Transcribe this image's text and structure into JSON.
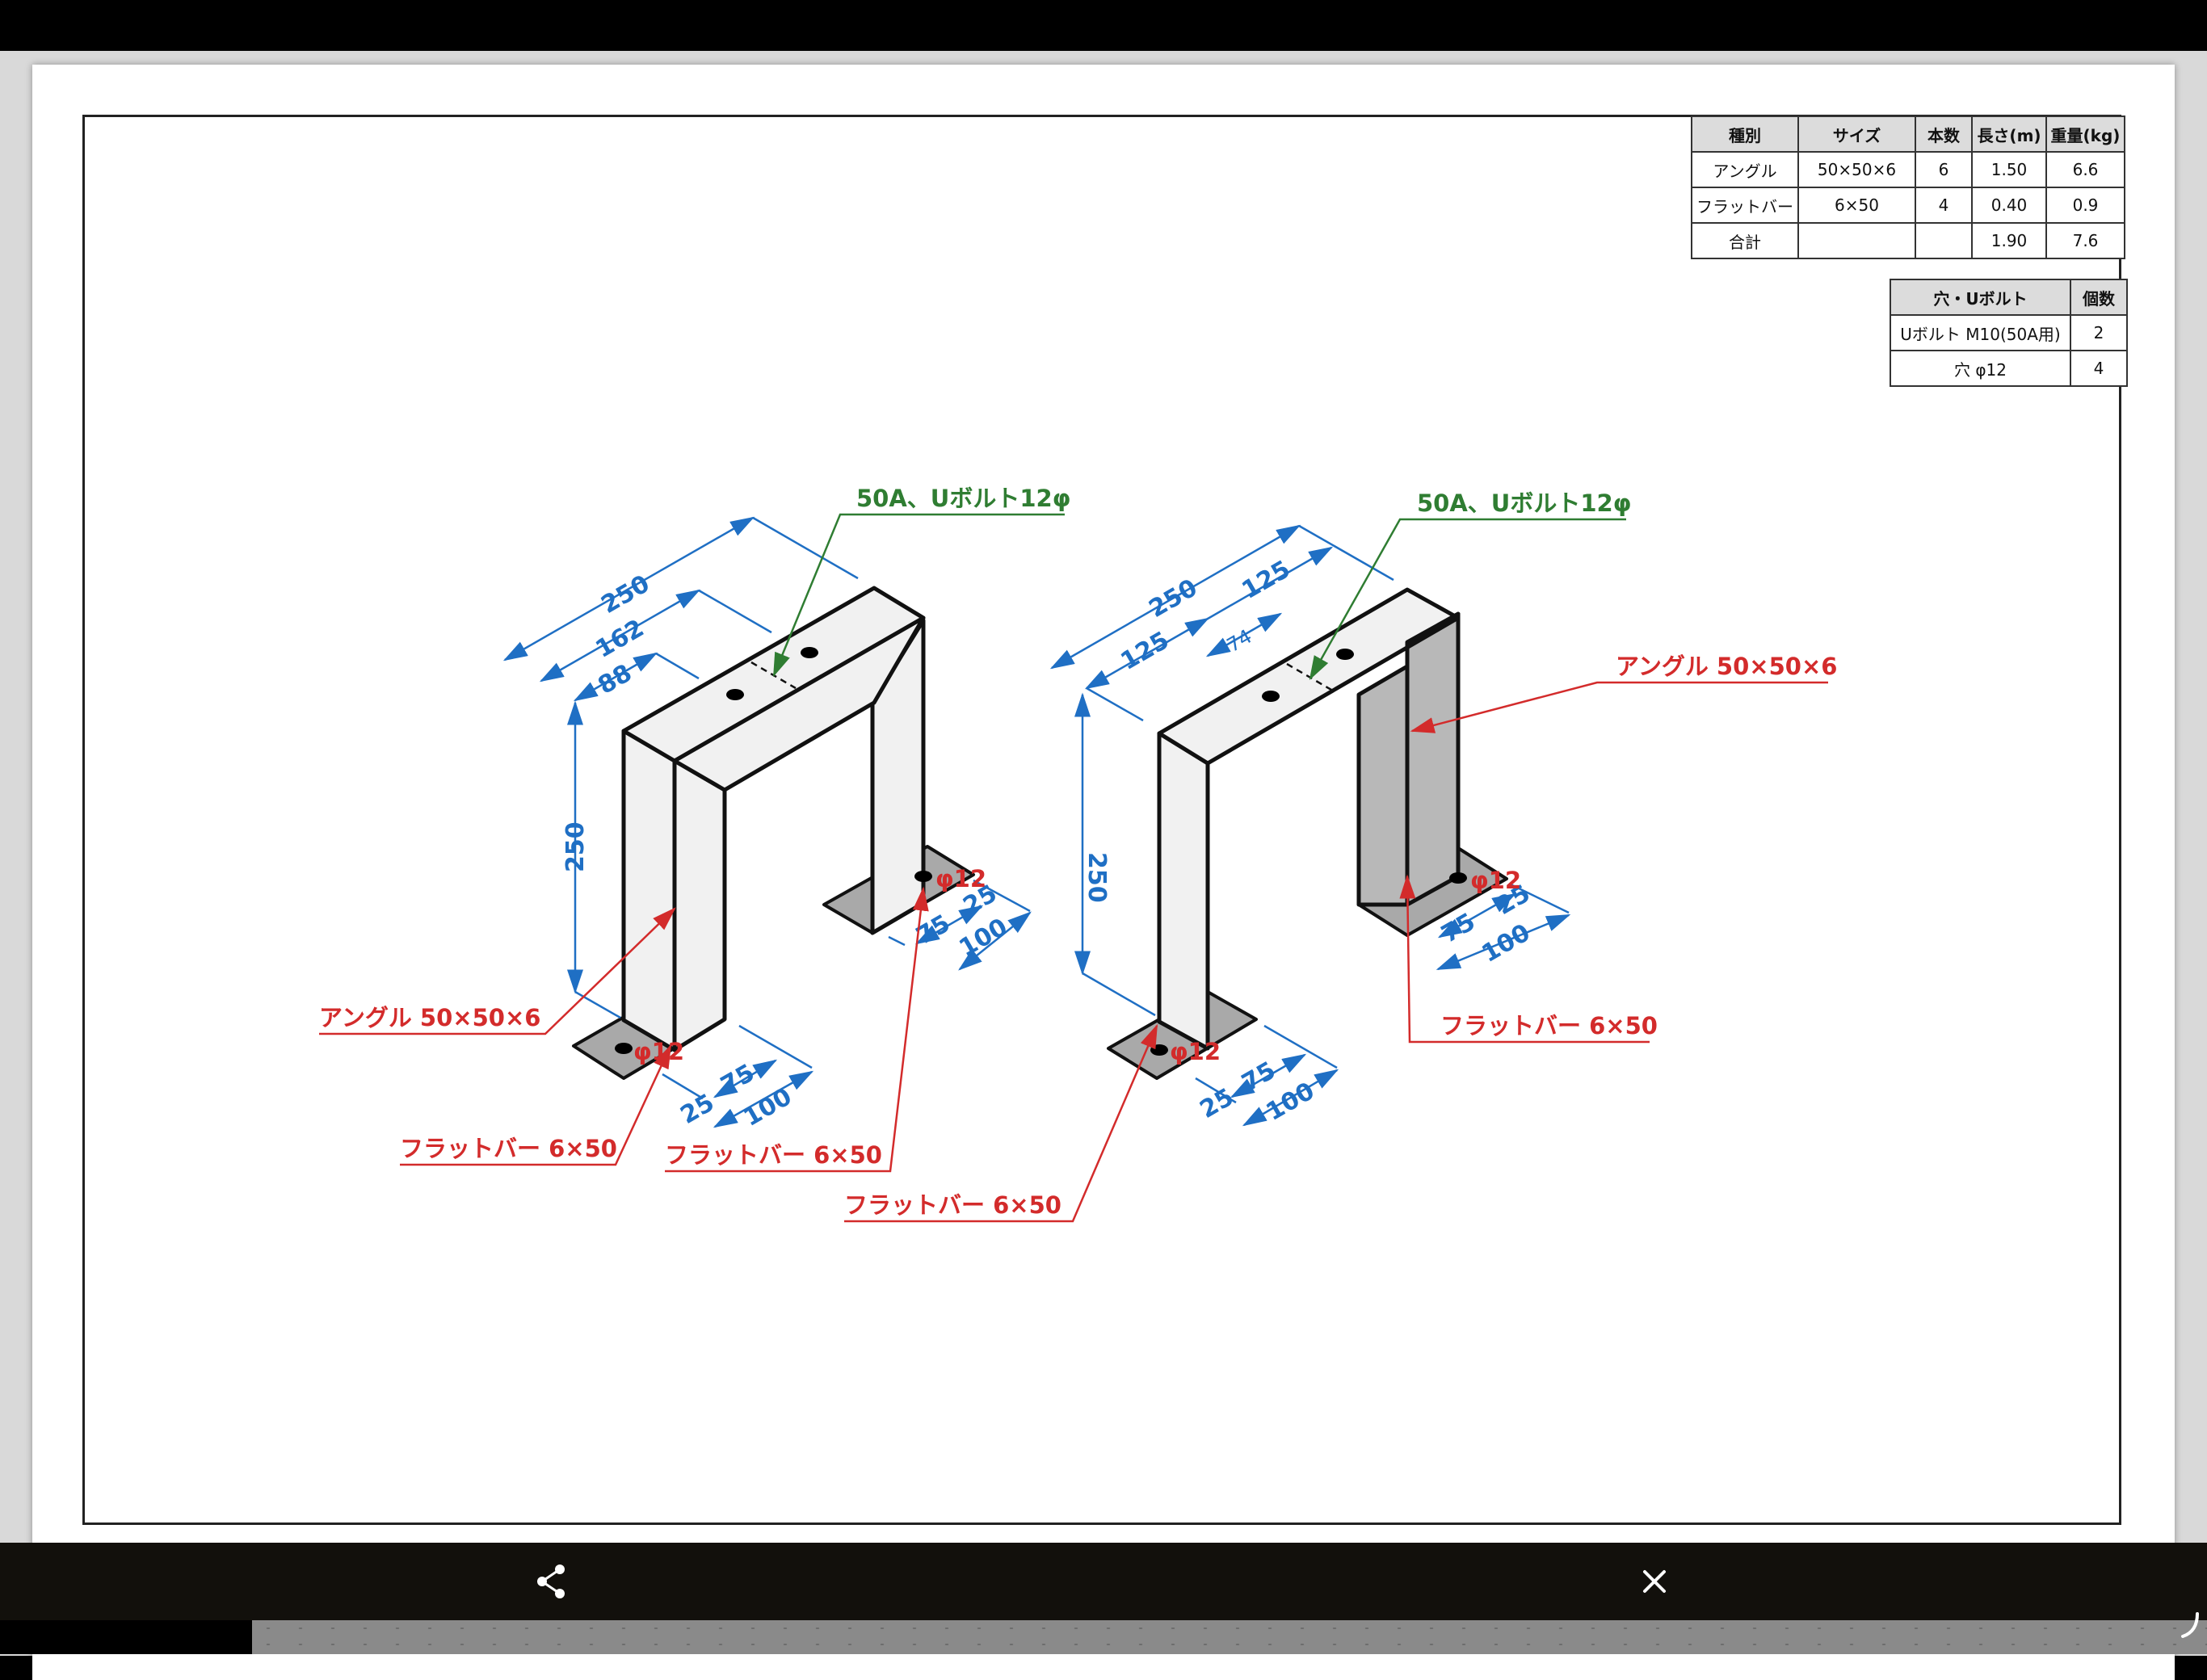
{
  "table1": {
    "headers": [
      "種別",
      "サイズ",
      "本数",
      "長さ(m)",
      "重量(kg)"
    ],
    "rows": [
      [
        "アングル",
        "50×50×6",
        "6",
        "1.50",
        "6.6"
      ],
      [
        "フラットバー",
        "6×50",
        "4",
        "0.40",
        "0.9"
      ],
      [
        "合計",
        "",
        "",
        "1.90",
        "7.6"
      ]
    ]
  },
  "table2": {
    "headers": [
      "穴・Uボルト",
      "個数"
    ],
    "rows": [
      [
        "Uボルト M10(50A用)",
        "2"
      ],
      [
        "穴 φ12",
        "4"
      ]
    ]
  },
  "drawing_left": {
    "dim_250_top": "250",
    "dim_162": "162",
    "dim_88": "88",
    "dim_250_vertical": "250",
    "ubolt_label": "50A、Uボルト12φ",
    "angle_label": "アングル 50×50×6",
    "flatbar_label_1": "フラットバー 6×50",
    "flatbar_label_2": "フラットバー 6×50",
    "hole_label_front": "φ12",
    "hole_label_back": "φ12",
    "front_25": "25",
    "front_75": "75",
    "front_100": "100",
    "back_25": "25",
    "back_75": "75",
    "back_100": "100"
  },
  "drawing_right": {
    "dim_250_top": "250",
    "dim_125_a": "125",
    "dim_125_b": "125",
    "dim_74": "74",
    "dim_250_vertical": "250",
    "ubolt_label": "50A、Uボルト12φ",
    "angle_label": "アングル 50×50×6",
    "flatbar_label_1": "フラットバー 6×50",
    "flatbar_label_2": "フラットバー 6×50",
    "hole_label_front": "φ12",
    "hole_label_back": "φ12",
    "front_25": "25",
    "front_75": "75",
    "front_100": "100",
    "back_25": "25",
    "back_75": "75",
    "back_100": "100"
  },
  "toolbar": {
    "share_icon": "share-icon",
    "close_icon": "close-icon"
  }
}
